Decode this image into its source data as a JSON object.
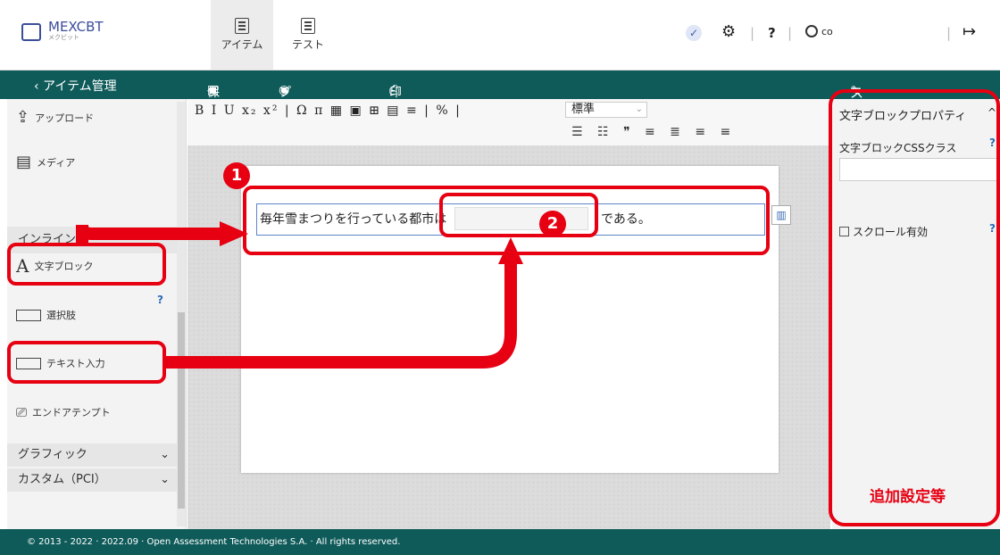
{
  "header": {
    "logo_text": "MEXCBT",
    "logo_sub": "メクビット",
    "nav": [
      {
        "label": "アイテム",
        "icon": "item-icon"
      },
      {
        "label": "テスト",
        "icon": "test-icon"
      }
    ],
    "check_glyph": "✓",
    "settings_glyph": "⚙",
    "help_label": "?",
    "user_label": "co",
    "logout_glyph": "↦"
  },
  "actionbar": {
    "back_label": "‹ アイテム管理",
    "save_label": "保存",
    "preview_label": "プレビュー",
    "print_label": "印刷",
    "style_editor_label": "スタイルエディタ"
  },
  "left_panel": {
    "upload_label": "アップロード",
    "media_label": "メディア",
    "inline_section": "インライン",
    "text_block_label": "文字ブロック",
    "choice_label": "選択肢",
    "text_entry_label": "テキスト入力",
    "end_attempt_label": "エンドアテンプト",
    "graphic_section": "グラフィック",
    "custom_section": "カスタム（PCI）",
    "help_label": "?"
  },
  "toolbar": {
    "row1": "B I U x₂ x² | Ω π ▦ ▣ ⊞ ▤ ≡ | % |",
    "format_select": "標準",
    "row2": "☰ ☷ ❞ ≡ ≣ ≡ ≡"
  },
  "canvas": {
    "sentence_before": "毎年雪まつりを行っている都市は",
    "sentence_after": "である。"
  },
  "right_panel": {
    "section_title": "文字ブロックプロパティ",
    "css_class_label": "文字ブロックCSSクラス",
    "css_class_value": "",
    "scroll_label": "スクロール有効",
    "help": "?"
  },
  "annotations": {
    "badge1": "1",
    "badge2": "2",
    "note": "追加設定等",
    "accent": "#e60012"
  },
  "footer": {
    "copyright": "© 2013 - 2022 · 2022.09 · Open Assessment Technologies S.A. · All rights reserved."
  }
}
